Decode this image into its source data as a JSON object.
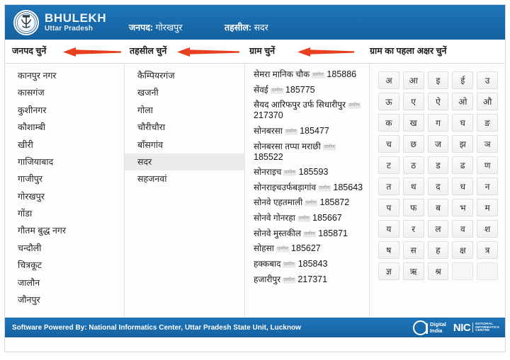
{
  "colors": {
    "header_blue": "#1a6cae",
    "arrow_red": "#e8401f",
    "selected_row": "#ebebeb"
  },
  "header": {
    "brand_title": "BHULEKH",
    "brand_subtitle": "Uttar Pradesh",
    "emblem_name": "up-government-emblem",
    "district_label": "जनपद:",
    "district_value": "गोरखपुर",
    "tehsil_label": "तहसील:",
    "tehsil_value": "सदर"
  },
  "captions": {
    "district": "जनपद चुनें",
    "tehsil": "तहसील चुनें",
    "village": "ग्राम चुनें",
    "alphabet": "ग्राम का पहला अक्षर चुनें"
  },
  "districts": [
    "कानपुर नगर",
    "कासगंज",
    "कुशीनगर",
    "कौशाम्बी",
    "खीरी",
    "गाजियाबाद",
    "गाजीपुर",
    "गोरखपुर",
    "गोंडा",
    "गौतम बुद्ध नगर",
    "चन्दौली",
    "चित्रकूट",
    "जालौन",
    "जौनपुर"
  ],
  "tehsils": [
    "कैम्पियरगंज",
    "खजनी",
    "गोला",
    "चौरीचौरा",
    "बाँसगांव",
    "सदर",
    "सहजनवां"
  ],
  "tehsil_selected": "सदर",
  "villages": [
    {
      "name": "सेमरा मानिक चौक",
      "tag": "ग्रामीण",
      "code": "185886"
    },
    {
      "name": "सेंवई",
      "tag": "ग्रामीण",
      "code": "185775"
    },
    {
      "name": "सैयद आरिफपुर उर्फ सिधारीपुर",
      "tag": "ग्रामीण",
      "code": "217370"
    },
    {
      "name": "सोनबरसा",
      "tag": "ग्रामीण",
      "code": "185477"
    },
    {
      "name": "सोनबरसा तप्पा मराछी",
      "tag": "ग्रामीण",
      "code": "185522"
    },
    {
      "name": "सोनराइच",
      "tag": "ग्रामीण",
      "code": "185593"
    },
    {
      "name": "सोनराइचउर्फबड़ागांव",
      "tag": "ग्रामीण",
      "code": "185643"
    },
    {
      "name": "सोनवे एहतमाली",
      "tag": "ग्रामीण",
      "code": "185872"
    },
    {
      "name": "सोनवे गोनरहा",
      "tag": "ग्रामीण",
      "code": "185667"
    },
    {
      "name": "सोनवे मुस्तकील",
      "tag": "ग्रामीण",
      "code": "185871"
    },
    {
      "name": "सोहसा",
      "tag": "ग्रामीण",
      "code": "185627"
    },
    {
      "name": "हक्कबाद",
      "tag": "ग्रामीण",
      "code": "185843"
    },
    {
      "name": "हजारीपुर",
      "tag": "ग्रामीण",
      "code": "217371"
    }
  ],
  "alphabet": [
    "अ",
    "आ",
    "इ",
    "ई",
    "उ",
    "ऊ",
    "ए",
    "ऐ",
    "ओ",
    "औ",
    "क",
    "ख",
    "ग",
    "घ",
    "ङ",
    "च",
    "छ",
    "ज",
    "झ",
    "ञ",
    "ट",
    "ठ",
    "ड",
    "ढ",
    "ण",
    "त",
    "थ",
    "द",
    "ध",
    "न",
    "प",
    "फ",
    "ब",
    "भ",
    "म",
    "य",
    "र",
    "ल",
    "व",
    "श",
    "ष",
    "स",
    "ह",
    "क्ष",
    "त्र",
    "ज्ञ",
    "ऋ",
    "श्र",
    "",
    ""
  ],
  "footer": {
    "text": "Software Powered By: National Informatics Center, Uttar Pradesh State Unit, Lucknow",
    "digital_india_line1": "Digital",
    "digital_india_line2": "India",
    "nic_mark": "NIC",
    "nic_line1": "NATIONAL",
    "nic_line2": "INFORMATICS",
    "nic_line3": "CENTRE"
  }
}
